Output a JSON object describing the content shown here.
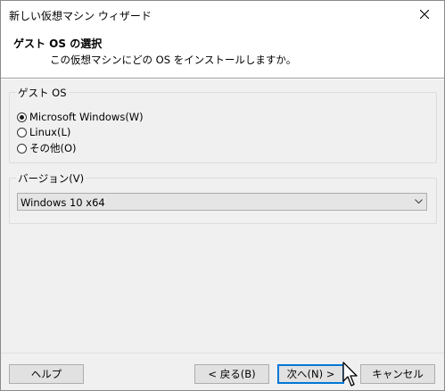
{
  "window": {
    "title": "新しい仮想マシン ウィザード"
  },
  "header": {
    "title": "ゲスト OS の選択",
    "subtitle": "この仮想マシンにどの OS をインストールしますか。"
  },
  "guest_os": {
    "group_label": "ゲスト OS",
    "options": [
      {
        "label": "Microsoft Windows(W)",
        "checked": true
      },
      {
        "label": "Linux(L)",
        "checked": false
      },
      {
        "label": "その他(O)",
        "checked": false
      }
    ]
  },
  "version": {
    "group_label": "バージョン(V)",
    "selected": "Windows 10 x64"
  },
  "footer": {
    "help_label": "ヘルプ",
    "back_label": "< 戻る(B)",
    "next_label": "次へ(N) >",
    "cancel_label": "キャンセル"
  },
  "icons": {
    "close": "close-icon",
    "dropdown": "chevron-down-icon",
    "cursor": "mouse-pointer-icon"
  },
  "colors": {
    "dialog_bg": "#f0f0f0",
    "header_bg": "#ffffff",
    "default_button_border": "#0078d7",
    "button_bg": "#e1e1e1"
  }
}
